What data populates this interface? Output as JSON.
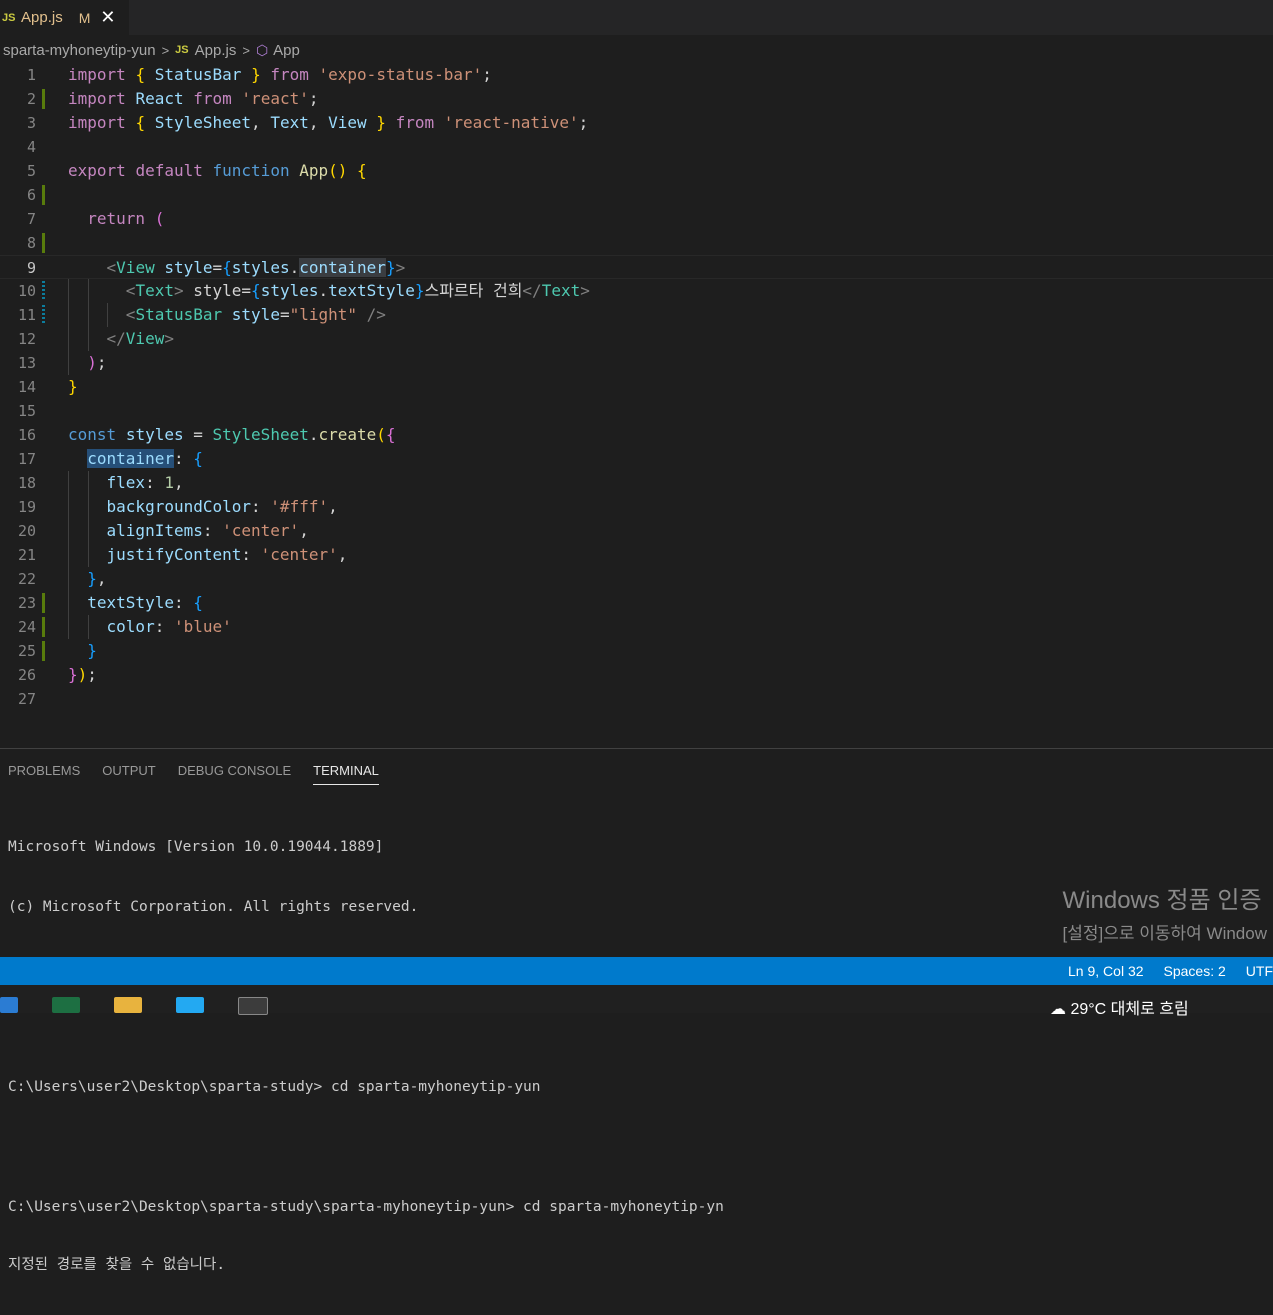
{
  "tab": {
    "badge": "JS",
    "filename": "App.js",
    "status": "M",
    "close": "✕"
  },
  "breadcrumb": [
    "sparta-myhoneytip-yun",
    "App.js",
    "App"
  ],
  "editor": {
    "line_numbers": [
      "1",
      "2",
      "3",
      "4",
      "5",
      "6",
      "7",
      "8",
      "9",
      "10",
      "11",
      "12",
      "13",
      "14",
      "15",
      "16",
      "17",
      "18",
      "19",
      "20",
      "21",
      "22",
      "23",
      "24",
      "25",
      "26",
      "27"
    ],
    "current_line": 9
  },
  "panel": {
    "tabs": [
      "PROBLEMS",
      "OUTPUT",
      "DEBUG CONSOLE",
      "TERMINAL"
    ],
    "active_tab": "TERMINAL",
    "terminal_lines": [
      "Microsoft Windows [Version 10.0.19044.1889]",
      "(c) Microsoft Corporation. All rights reserved.",
      "",
      "",
      "C:\\Users\\user2\\Desktop\\sparta-study> cd sparta-myhoneytip-yun",
      "",
      "C:\\Users\\user2\\Desktop\\sparta-study\\sparta-myhoneytip-yun> cd sparta-myhoneytip-yn",
      "지정된 경로를 찾을 수 없습니다."
    ]
  },
  "watermark": {
    "line1": "Windows 정품 인증",
    "line2": "[설정]으로 이동하여 Window"
  },
  "statusbar": {
    "position": "Ln 9, Col 32",
    "spaces": "Spaces: 2",
    "encoding": "UTF"
  },
  "taskbar": {
    "weather": "29°C 대체로 흐림"
  },
  "colors": {
    "accent": "#007acc",
    "added": "#587c0c",
    "modified": "#0c7d9d"
  }
}
